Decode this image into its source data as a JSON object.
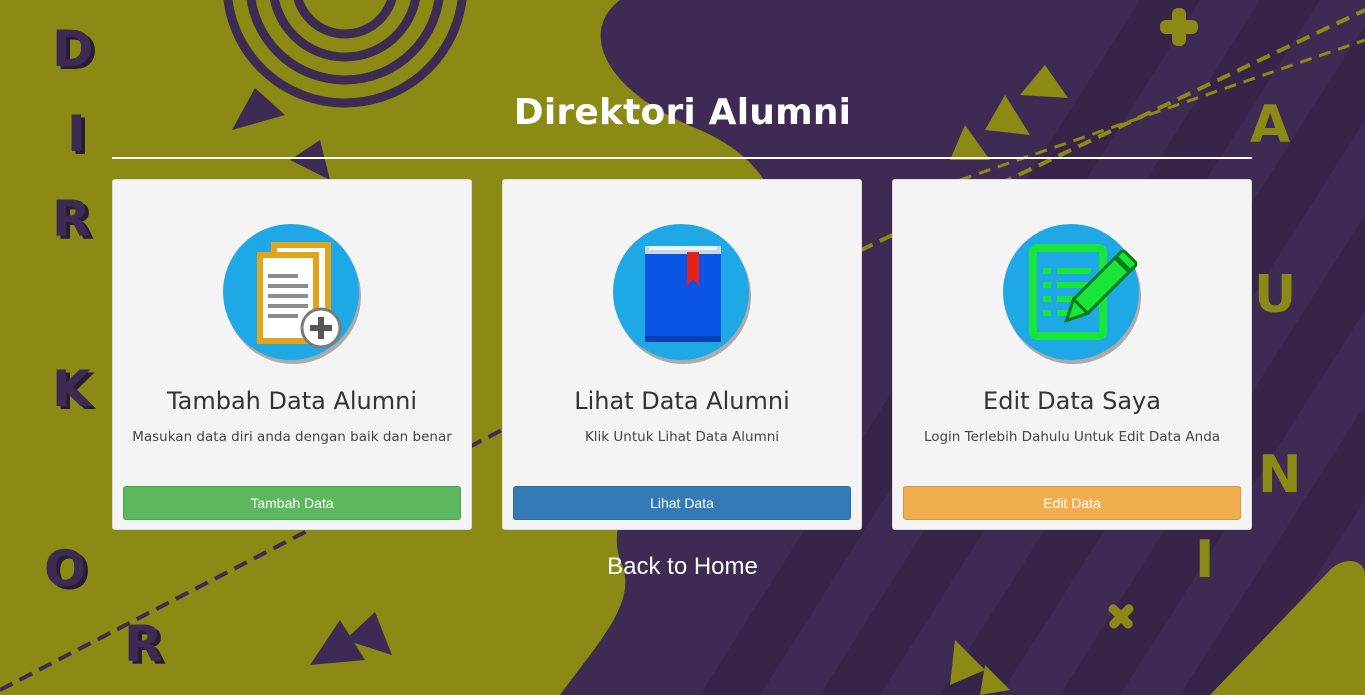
{
  "page": {
    "title": "Direktori Alumni",
    "back_link": "Back to Home"
  },
  "decor": {
    "left_letters": [
      "D",
      "I",
      "R",
      "K",
      "O",
      "R"
    ],
    "right_letters": [
      "A",
      "U",
      "N",
      "I"
    ]
  },
  "cards": [
    {
      "title": "Tambah Data Alumni",
      "description": "Masukan data diri anda dengan baik dan benar",
      "button": "Tambah Data",
      "icon": "add-document-icon"
    },
    {
      "title": "Lihat Data Alumni",
      "description": "Klik Untuk Lihat Data Alumni",
      "button": "Lihat Data",
      "icon": "book-icon"
    },
    {
      "title": "Edit Data Saya",
      "description": "Login Terlebih Dahulu Untuk Edit Data Anda",
      "button": "Edit Data",
      "icon": "edit-document-icon"
    }
  ],
  "colors": {
    "olive": "#8a8a14",
    "purple": "#3f2a54",
    "btn_green": "#5cb85c",
    "btn_blue": "#337ab7",
    "btn_orange": "#f0ad4e",
    "icon_circle": "#1fa8e6"
  }
}
